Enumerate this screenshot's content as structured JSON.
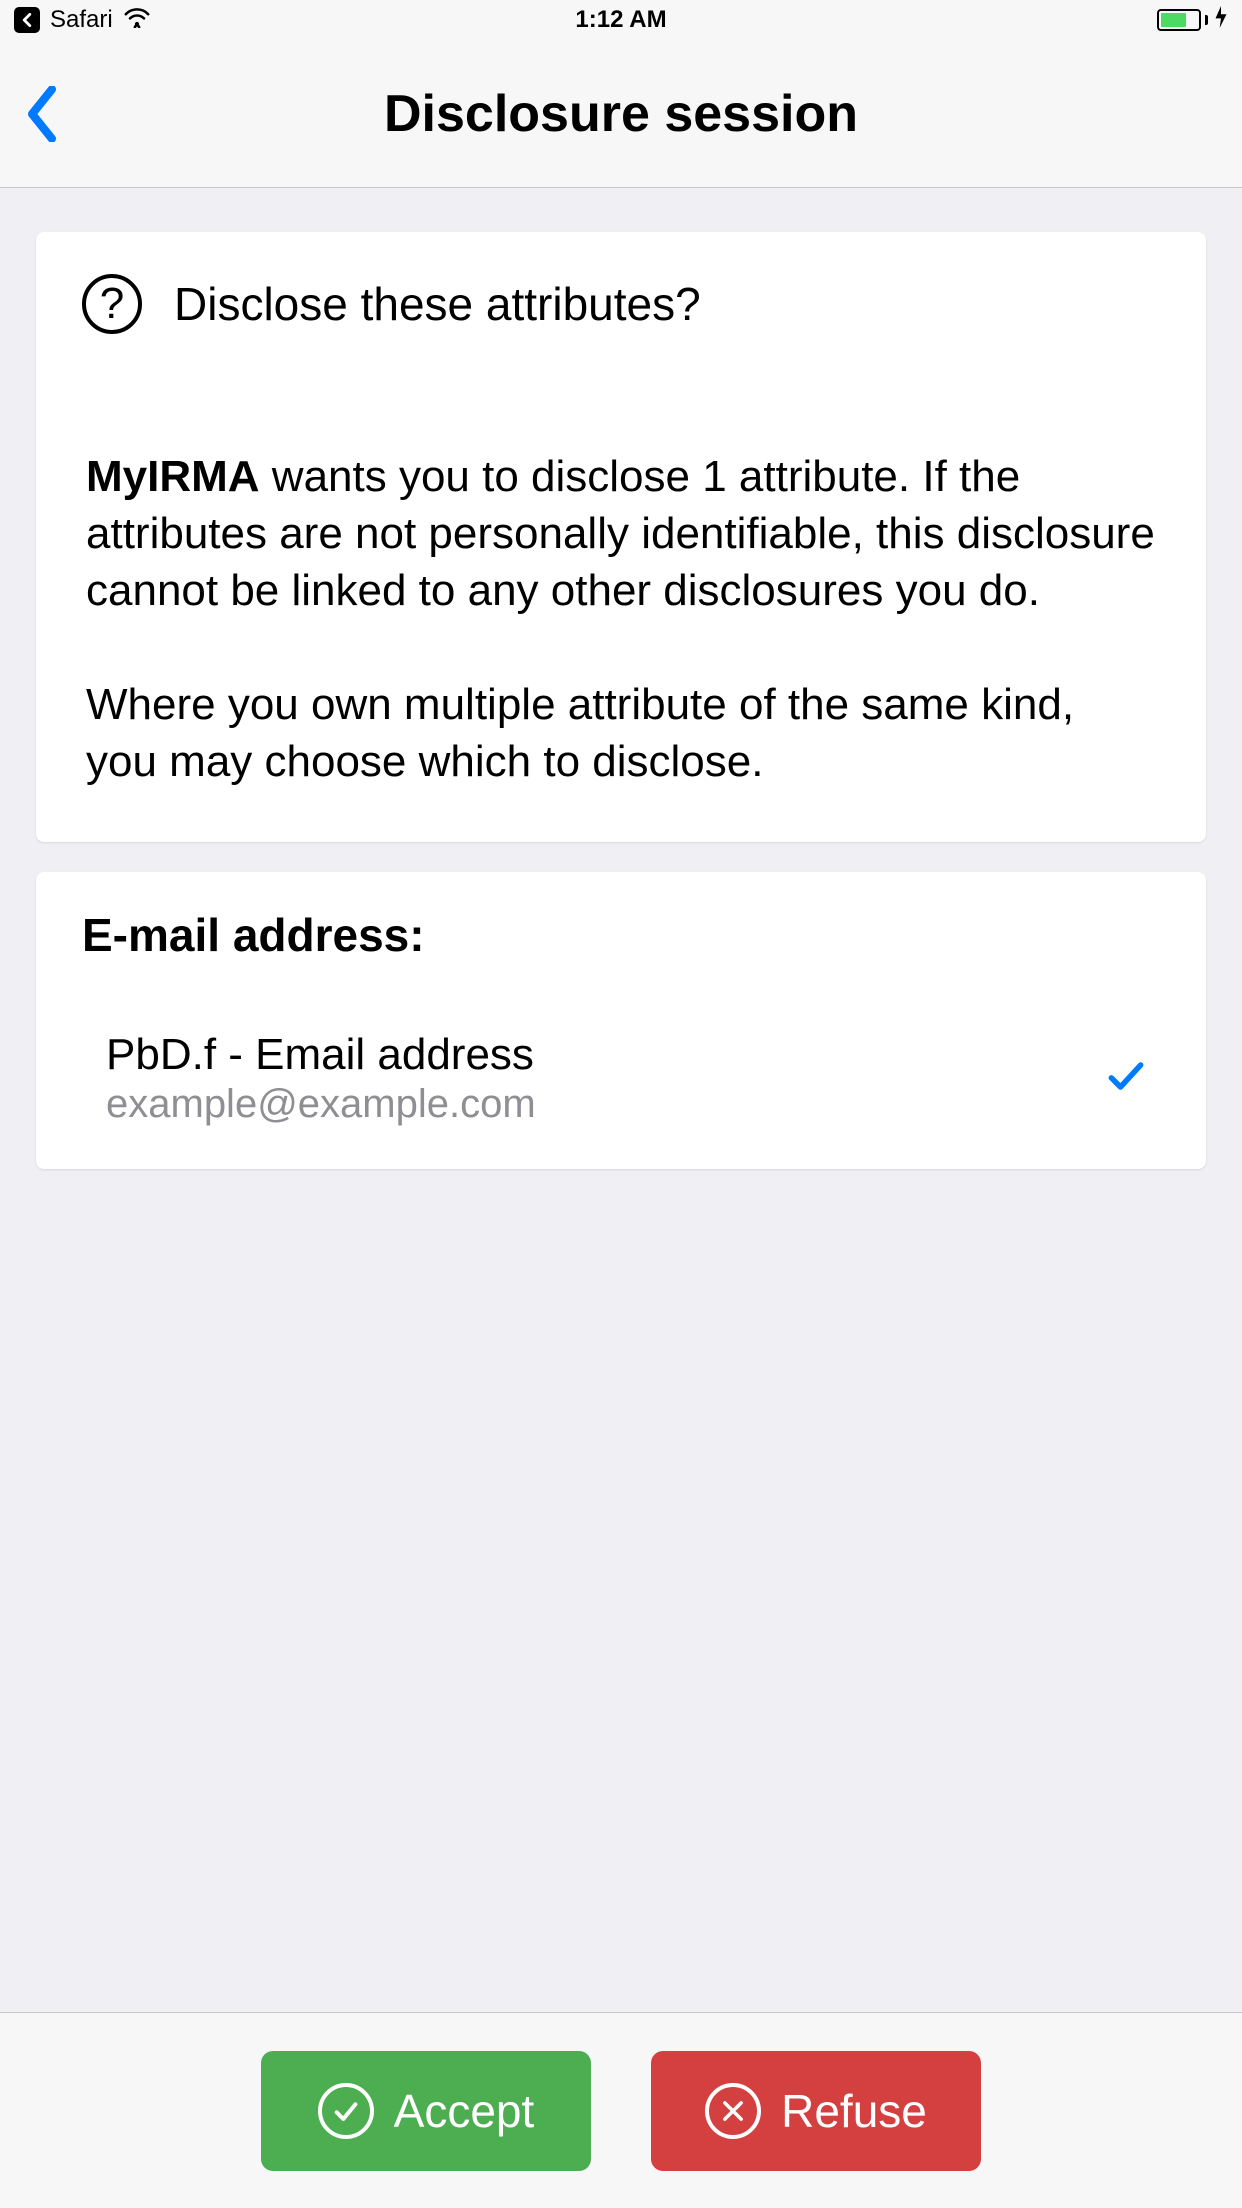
{
  "status_bar": {
    "back_app": "Safari",
    "time": "1:12 AM"
  },
  "nav": {
    "title": "Disclosure session"
  },
  "card": {
    "question": "Disclose these attributes?",
    "requester": "MyIRMA",
    "body_after_bold": " wants you to disclose 1 attribute. If the attributes are not personally identifiable, this disclosure cannot be linked to any other disclosures you do.",
    "body_p2": "Where you own multiple attribute of the same kind, you may choose which to disclose."
  },
  "attribute": {
    "label": "E-mail address:",
    "issuer": "PbD.f - Email address",
    "value": "example@example.com"
  },
  "buttons": {
    "accept": "Accept",
    "refuse": "Refuse"
  }
}
